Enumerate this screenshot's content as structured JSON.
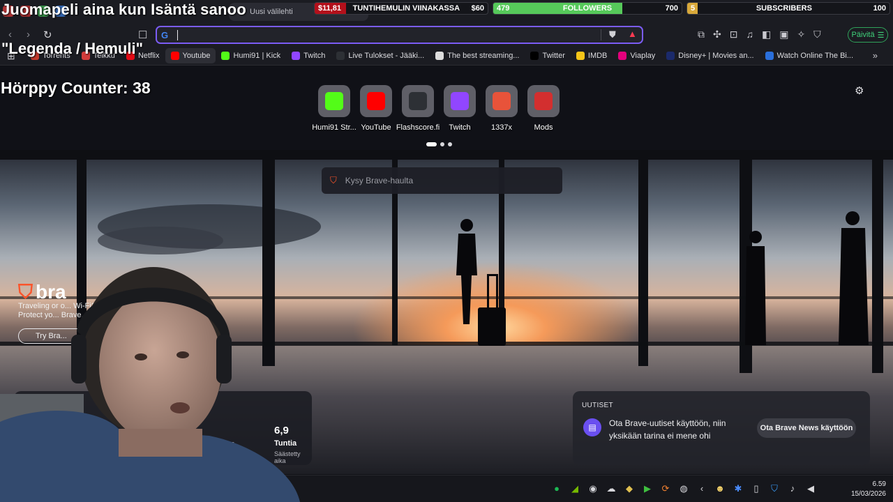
{
  "overlay": {
    "title": "Juomapeli aina kun Isäntä sanoo",
    "quote": "\"Legenda / Hemuli\"",
    "counter_label": "Hörppy Counter: 38"
  },
  "goals": [
    {
      "amount": "$11,81",
      "label": "TUNTIHEMULIN VIINAKASSA",
      "target": "$60",
      "color": "#b3101b",
      "progress": 0.18
    },
    {
      "amount": "479",
      "label": "FOLLOWERS",
      "target": "700",
      "color": "#56c95a",
      "progress": 0.684
    },
    {
      "amount": "5",
      "label": "SUBSCRIBERS",
      "target": "100",
      "color": "#d8a83a",
      "progress": 0.05
    }
  ],
  "tabs": {
    "active_title": "Uusi välilehti"
  },
  "address_bar": {
    "value": "",
    "update_label": "Päivitä"
  },
  "bookmarks": [
    {
      "label": "Torrents",
      "icon": "torrent-icon",
      "color": "#c0392b"
    },
    {
      "label": "Telkku",
      "icon": "telkku-icon",
      "color": "#d23c3c"
    },
    {
      "label": "Netflix",
      "icon": "netflix-icon",
      "color": "#e50914"
    },
    {
      "label": "Youtube",
      "icon": "youtube-icon",
      "color": "#ff0000"
    },
    {
      "label": "Humi91 | Kick",
      "icon": "kick-icon",
      "color": "#53fc18"
    },
    {
      "label": "Twitch",
      "icon": "twitch-icon",
      "color": "#9146ff"
    },
    {
      "label": "Live Tulokset - Jääki...",
      "icon": "flashscore-icon",
      "color": "#2d3035"
    },
    {
      "label": "The best streaming...",
      "icon": "streaming-icon",
      "color": "#dddddd"
    },
    {
      "label": "Twitter",
      "icon": "x-icon",
      "color": "#000000"
    },
    {
      "label": "IMDB",
      "icon": "imdb-icon",
      "color": "#f5c518"
    },
    {
      "label": "Viaplay",
      "icon": "viaplay-icon",
      "color": "#e4007c"
    },
    {
      "label": "Disney+ | Movies an...",
      "icon": "disney-icon",
      "color": "#1b2a6b"
    },
    {
      "label": "Watch Online The Bi...",
      "icon": "globe-icon",
      "color": "#2a6fdb"
    }
  ],
  "top_sites": [
    {
      "label": "Humi91 Str...",
      "icon": "kick-icon",
      "color": "#53fc18"
    },
    {
      "label": "YouTube",
      "icon": "youtube-icon",
      "color": "#ff0000"
    },
    {
      "label": "Flashscore.fi",
      "icon": "flashscore-icon",
      "color": "#2d3035"
    },
    {
      "label": "Twitch",
      "icon": "twitch-icon",
      "color": "#9146ff"
    },
    {
      "label": "1337x",
      "icon": "1337x-icon",
      "color": "#e8533a"
    },
    {
      "label": "Mods",
      "icon": "mods-icon",
      "color": "#d32f2f"
    }
  ],
  "search": {
    "placeholder": "Kysy Brave-haulta"
  },
  "promo": {
    "brand": "bra",
    "text": "Traveling or o... Wi-Fi? No... Protect yo... Brave...",
    "button": "Try Bra..."
  },
  "stats": {
    "time_value": "6,9",
    "time_unit": "Tuntia",
    "time_label": "Säästetty aika",
    "bandwidth_label": "...leveys"
  },
  "news": {
    "title": "UUTISET",
    "text": "Ota Brave-uutiset käyttöön, niin yksikään tarina ei mene ohi",
    "button": "Ota Brave News käyttöön"
  },
  "clock": {
    "time": "6.59",
    "date": "15/03/2026"
  },
  "colors": {
    "accent": "#7b5cf5",
    "update_green": "#3fd27a"
  }
}
